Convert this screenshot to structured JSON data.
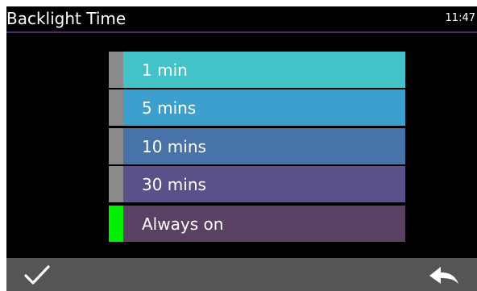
{
  "header": {
    "title": "Backlight Time",
    "time": "11:47"
  },
  "options": [
    {
      "label": "1 min",
      "bg": "#43c3c7",
      "indicator": "#8a8a8a",
      "selected": false
    },
    {
      "label": "5 mins",
      "bg": "#3d9fcd",
      "indicator": "#8a8a8a",
      "selected": false
    },
    {
      "label": "10 mins",
      "bg": "#4873a8",
      "indicator": "#8a8a8a",
      "selected": false
    },
    {
      "label": "30 mins",
      "bg": "#5b5188",
      "indicator": "#8a8a8a",
      "selected": false
    },
    {
      "label": "Always on",
      "bg": "#5a4164",
      "indicator": "#00ee00",
      "selected": true
    }
  ],
  "footer": {
    "confirm_icon": "checkmark-icon",
    "back_icon": "back-arrow-icon"
  },
  "colors": {
    "background": "#000000",
    "footer": "#555555",
    "title_underline": "#4a2a6a"
  }
}
